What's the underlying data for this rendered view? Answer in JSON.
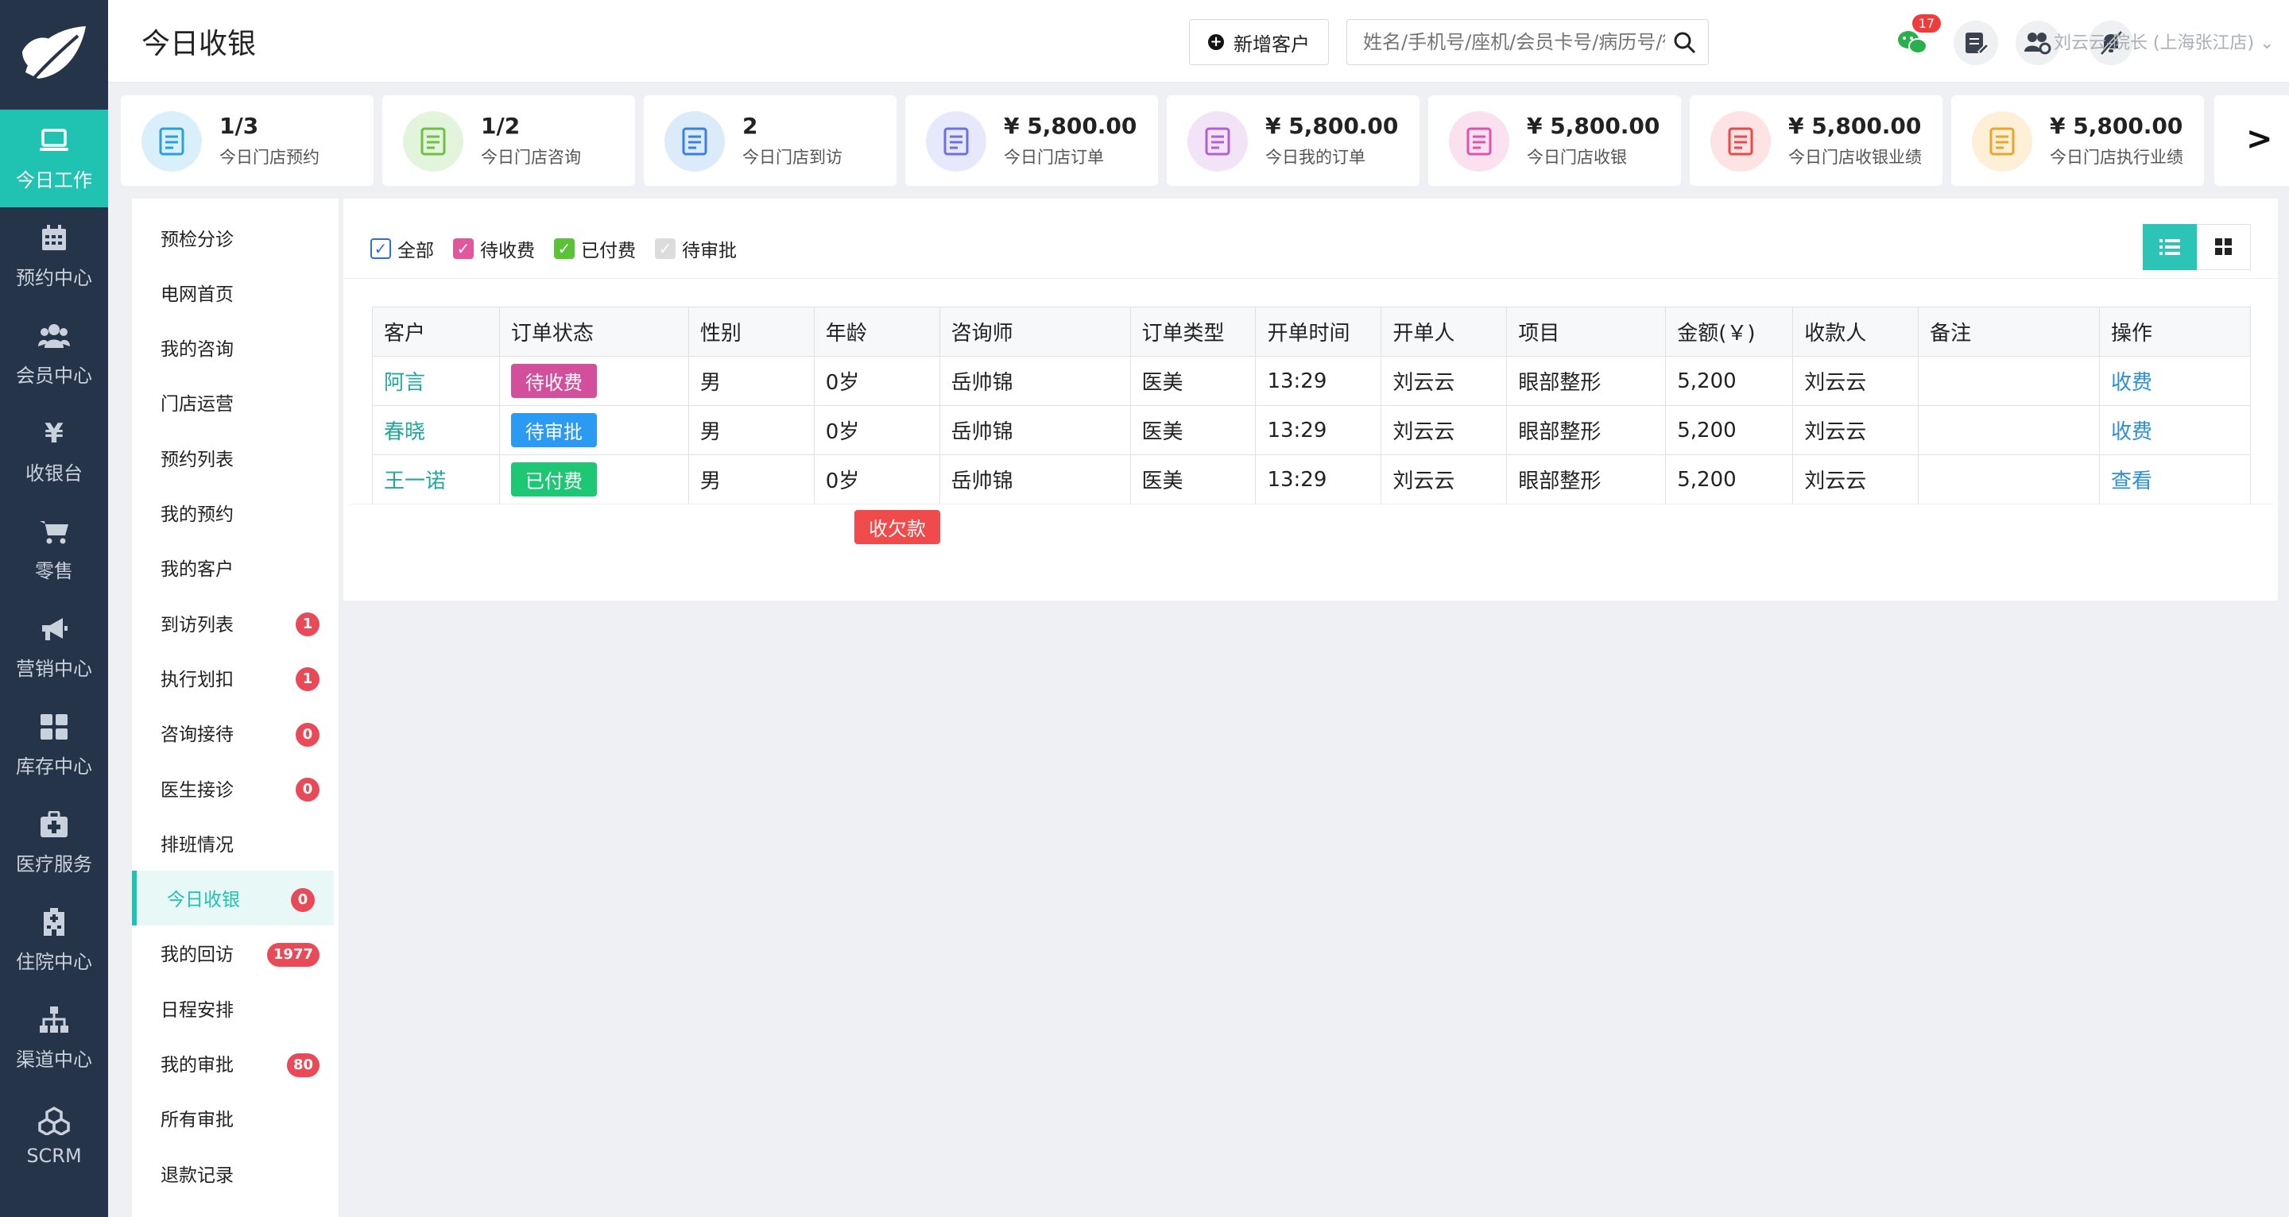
{
  "nav": {
    "items": [
      {
        "label": "今日工作",
        "icon": "laptop-icon"
      },
      {
        "label": "预约中心",
        "icon": "calendar-icon"
      },
      {
        "label": "会员中心",
        "icon": "users-icon"
      },
      {
        "label": "收银台",
        "icon": "yen-icon"
      },
      {
        "label": "零售",
        "icon": "cart-icon"
      },
      {
        "label": "营销中心",
        "icon": "megaphone-icon"
      },
      {
        "label": "库存中心",
        "icon": "grid-icon"
      },
      {
        "label": "医疗服务",
        "icon": "medkit-icon"
      },
      {
        "label": "住院中心",
        "icon": "hospital-icon"
      },
      {
        "label": "渠道中心",
        "icon": "sitemap-icon"
      },
      {
        "label": "SCRM",
        "icon": "cubes-icon"
      }
    ]
  },
  "header": {
    "title": "今日收银",
    "new_customer": "新增客户",
    "search_placeholder": "姓名/手机号/座机/会员卡号/病历号/微信号",
    "wechat_badge": "17",
    "user": "刘云云-院长 (上海张江店)"
  },
  "stats": [
    {
      "value": "1/3",
      "label": "今日门店预约",
      "color": "#d9f0fb"
    },
    {
      "value": "1/2",
      "label": "今日门店咨询",
      "color": "#e3f4dd"
    },
    {
      "value": "2",
      "label": "今日门店到访",
      "color": "#dcebfa"
    },
    {
      "value": "¥ 5,800.00",
      "label": "今日门店订单",
      "color": "#e6e8fb"
    },
    {
      "value": "¥ 5,800.00",
      "label": "今日我的订单",
      "color": "#f2e3f7"
    },
    {
      "value": "¥ 5,800.00",
      "label": "今日门店收银",
      "color": "#fbe1f0"
    },
    {
      "value": "¥ 5,800.00",
      "label": "今日门店收银业绩",
      "color": "#fde3e3"
    },
    {
      "value": "¥ 5,800.00",
      "label": "今日门店执行业绩",
      "color": "#fdf0d6"
    }
  ],
  "next_label": ">",
  "menu": [
    {
      "label": "预检分诊"
    },
    {
      "label": "电网首页"
    },
    {
      "label": "我的咨询"
    },
    {
      "label": "门店运营"
    },
    {
      "label": "预约列表"
    },
    {
      "label": "我的预约"
    },
    {
      "label": "我的客户"
    },
    {
      "label": "到访列表",
      "count": "1"
    },
    {
      "label": "执行划扣",
      "count": "1"
    },
    {
      "label": "咨询接待",
      "count": "0"
    },
    {
      "label": "医生接诊",
      "count": "0"
    },
    {
      "label": "排班情况"
    },
    {
      "label": "今日收银",
      "count": "0",
      "active": true
    },
    {
      "label": "我的回访",
      "count": "1977"
    },
    {
      "label": "日程安排"
    },
    {
      "label": "我的审批",
      "count": "80"
    },
    {
      "label": "所有审批"
    },
    {
      "label": "退款记录"
    }
  ],
  "filters": [
    {
      "label": "全部",
      "color": "#2d6fd6",
      "checked": true
    },
    {
      "label": "待收费",
      "color": "#e0579e",
      "checked": true
    },
    {
      "label": "已付费",
      "color": "#5bc236",
      "checked": true
    },
    {
      "label": "待审批",
      "color": "#dcdcdc",
      "checked": true
    }
  ],
  "table": {
    "headers": [
      "客户",
      "订单状态",
      "性别",
      "年龄",
      "咨询师",
      "订单类型",
      "开单时间",
      "开单人",
      "项目",
      "金额(￥)",
      "收款人",
      "备注",
      "操作"
    ],
    "rows": [
      {
        "customer": "阿言",
        "status": "待收费",
        "gender": "男",
        "age": "0岁",
        "consultant": "岳帅锦",
        "type": "医美",
        "time": "13:29",
        "creator": "刘云云",
        "project": "眼部整形",
        "amount": "5,200",
        "payee": "刘云云",
        "note": "",
        "op": "收费"
      },
      {
        "customer": "春晓",
        "status": "待审批",
        "gender": "男",
        "age": "0岁",
        "consultant": "岳帅锦",
        "type": "医美",
        "time": "13:29",
        "creator": "刘云云",
        "project": "眼部整形",
        "amount": "5,200",
        "payee": "刘云云",
        "note": "",
        "op": "收费"
      },
      {
        "customer": "王一诺",
        "status": "已付费",
        "gender": "男",
        "age": "0岁",
        "consultant": "岳帅锦",
        "type": "医美",
        "time": "13:29",
        "creator": "刘云云",
        "project": "眼部整形",
        "amount": "5,200",
        "payee": "刘云云",
        "note": "",
        "op": "查看"
      }
    ]
  },
  "arrears_label": "收欠款"
}
